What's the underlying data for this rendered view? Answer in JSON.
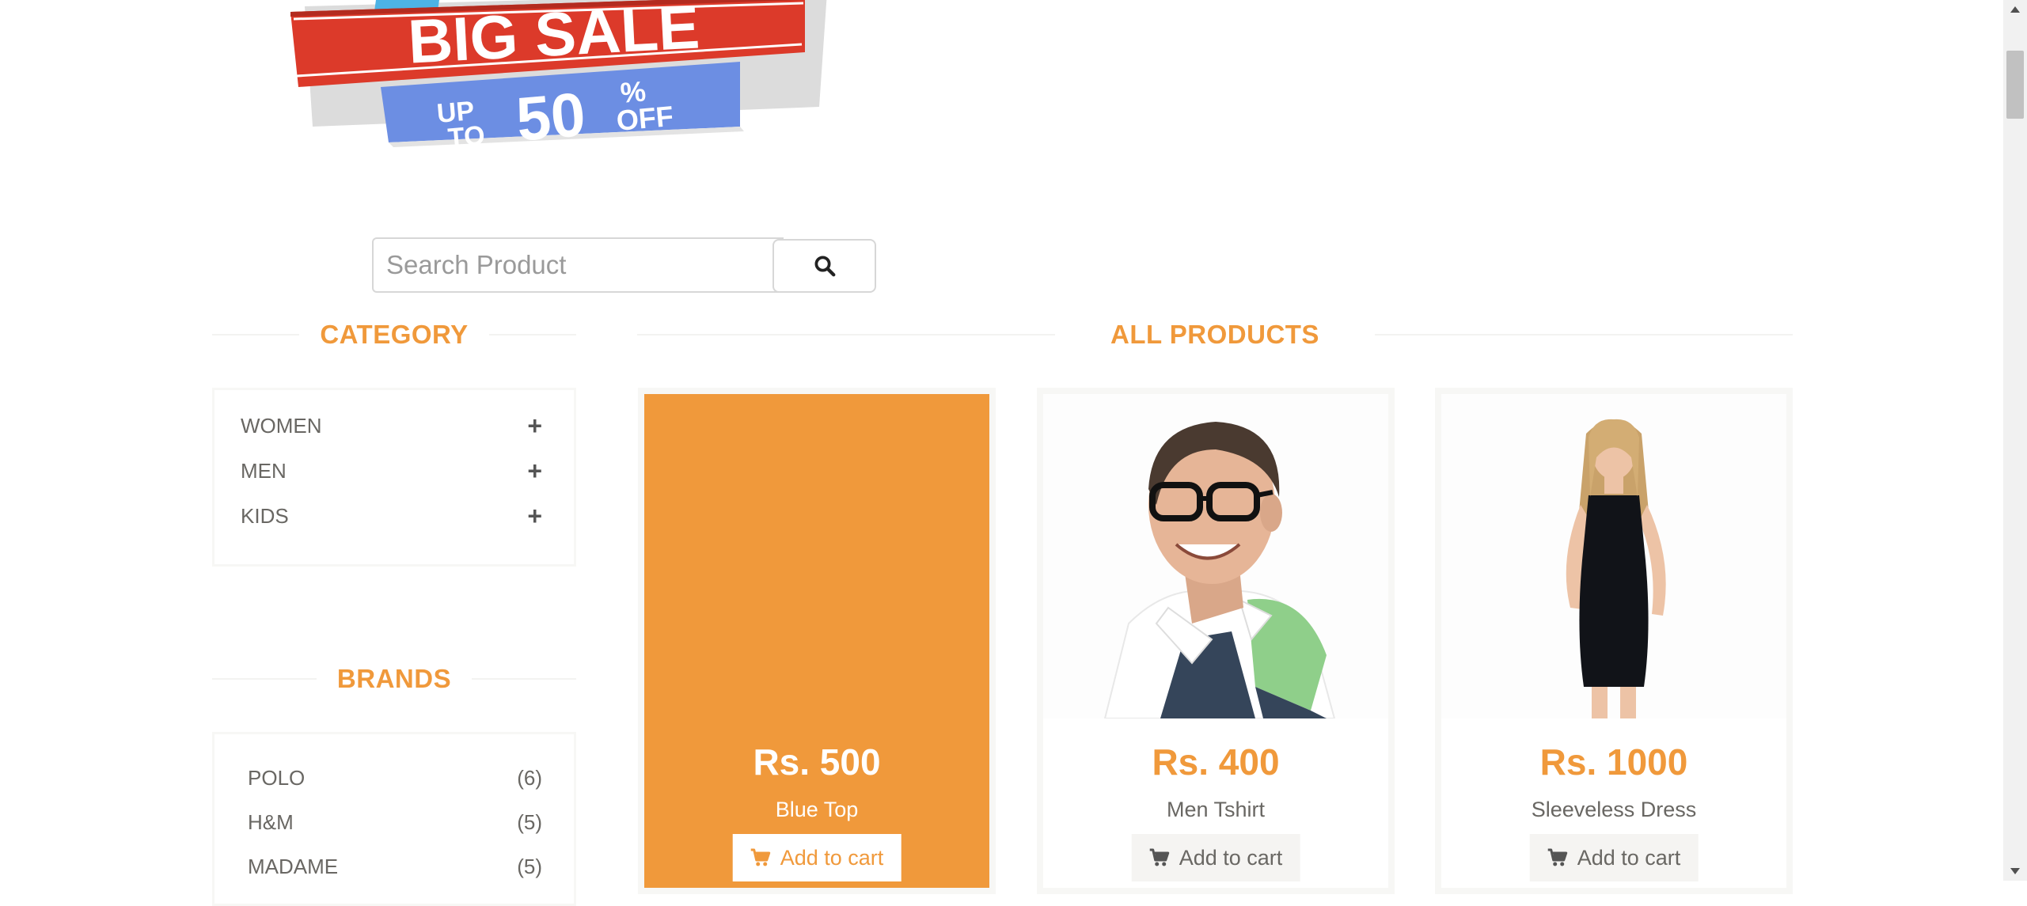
{
  "banner": {
    "headline": "BIG SALE",
    "up": "UP",
    "to": "TO",
    "amount": "50",
    "percent": "%",
    "off": "OFF"
  },
  "search": {
    "placeholder": "Search Product",
    "button_icon": "search-icon"
  },
  "sidebar": {
    "category_title": "CATEGORY",
    "categories": [
      {
        "label": "WOMEN",
        "icon": "plus-icon"
      },
      {
        "label": "MEN",
        "icon": "plus-icon"
      },
      {
        "label": "KIDS",
        "icon": "plus-icon"
      }
    ],
    "brands_title": "BRANDS",
    "brands": [
      {
        "label": "POLO",
        "count": "(6)"
      },
      {
        "label": "H&M",
        "count": "(5)"
      },
      {
        "label": "MADAME",
        "count": "(5)"
      }
    ]
  },
  "main": {
    "title": "ALL PRODUCTS",
    "products": [
      {
        "price": "Rs. 500",
        "name": "Blue Top",
        "cart_label": "Add to cart",
        "cart_icon": "shopping-cart-icon"
      },
      {
        "price": "Rs. 400",
        "name": "Men Tshirt",
        "cart_label": "Add to cart",
        "cart_icon": "shopping-cart-icon"
      },
      {
        "price": "Rs. 1000",
        "name": "Sleeveless Dress",
        "cart_label": "Add to cart",
        "cart_icon": "shopping-cart-icon"
      }
    ]
  },
  "colors": {
    "accent": "#f0993b",
    "text": "#696763",
    "banner_red": "#dc3a2a",
    "banner_blue": "#6c8ee3"
  }
}
